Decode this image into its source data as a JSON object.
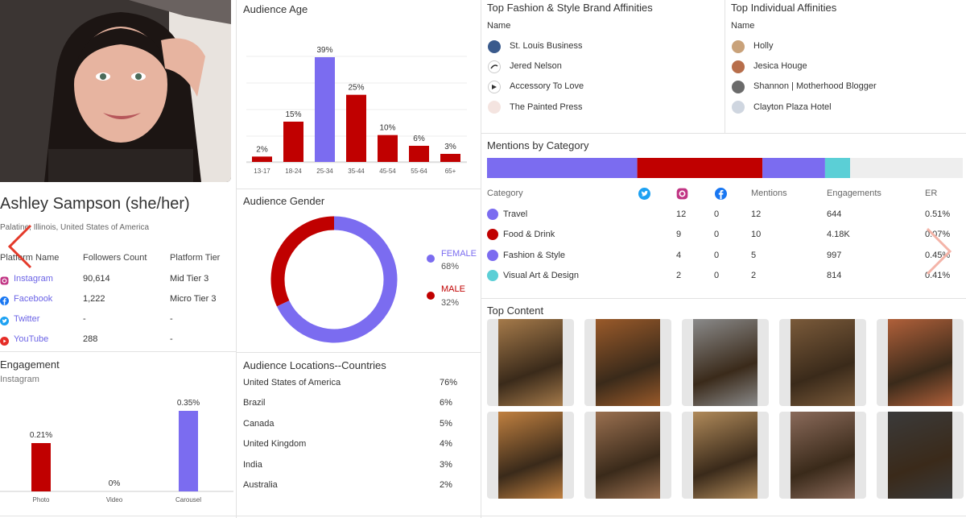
{
  "profile": {
    "name": "Ashley Sampson (she/her)",
    "location": "Palatine, Illinois, United States of America",
    "table_headers": [
      "Platform Name",
      "Followers Count",
      "Platform Tier"
    ],
    "platforms": [
      {
        "name": "Instagram",
        "followers": "90,614",
        "tier": "Mid Tier 3",
        "icon": "instagram-icon",
        "color": "#c13584"
      },
      {
        "name": "Facebook",
        "followers": "1,222",
        "tier": "Micro Tier 3",
        "icon": "facebook-icon",
        "color": "#1877f2"
      },
      {
        "name": "Twitter",
        "followers": "-",
        "tier": "-",
        "icon": "twitter-icon",
        "color": "#1da1f2"
      },
      {
        "name": "YouTube",
        "followers": "288",
        "tier": "-",
        "icon": "youtube-icon",
        "color": "#e52d27"
      }
    ]
  },
  "engagement": {
    "title": "Engagement",
    "subtitle": "Instagram",
    "chart_data": {
      "type": "bar",
      "categories": [
        "Photo",
        "Video",
        "Carousel"
      ],
      "values": [
        0.21,
        0,
        0.35
      ],
      "value_labels": [
        "0.21%",
        "0%",
        "0.35%"
      ],
      "colors": [
        "#c00000",
        "#7b6cf0",
        "#7b6cf0"
      ]
    }
  },
  "audience_age": {
    "title": "Audience Age",
    "chart_data": {
      "type": "bar",
      "categories": [
        "13-17",
        "18-24",
        "25-34",
        "35-44",
        "45-54",
        "55-64",
        "65+"
      ],
      "values": [
        2,
        15,
        39,
        25,
        10,
        6,
        3
      ],
      "value_labels": [
        "2%",
        "15%",
        "39%",
        "25%",
        "10%",
        "6%",
        "3%"
      ],
      "highlight_index": 2,
      "colors": {
        "default": "#c00000",
        "highlight": "#7b6cf0"
      }
    }
  },
  "audience_gender": {
    "title": "Audience Gender",
    "chart_data": {
      "type": "pie",
      "categories": [
        "FEMALE",
        "MALE"
      ],
      "values": [
        68,
        32
      ],
      "value_labels": [
        "68%",
        "32%"
      ],
      "colors": [
        "#7b6cf0",
        "#c00000"
      ]
    }
  },
  "audience_locations": {
    "title": "Audience Locations--Countries",
    "rows": [
      {
        "country": "United States of America",
        "pct": "76%"
      },
      {
        "country": "Brazil",
        "pct": "6%"
      },
      {
        "country": "Canada",
        "pct": "5%"
      },
      {
        "country": "United Kingdom",
        "pct": "4%"
      },
      {
        "country": "India",
        "pct": "3%"
      },
      {
        "country": "Australia",
        "pct": "2%"
      }
    ]
  },
  "brand_affinities": {
    "title": "Top Fashion & Style Brand Affinities",
    "column": "Name",
    "items": [
      {
        "name": "St. Louis Business",
        "color": "#3a5a8c"
      },
      {
        "name": "Jered Nelson",
        "color": "#2a2a2a"
      },
      {
        "name": "Accessory To Love",
        "color": "#555555"
      },
      {
        "name": "The Painted Press",
        "color": "#d9a0a0"
      }
    ]
  },
  "individual_affinities": {
    "title": "Top Individual Affinities",
    "column": "Name",
    "items": [
      {
        "name": "Holly",
        "color": "#c9a27a"
      },
      {
        "name": "Jesica Houge",
        "color": "#b76e4b"
      },
      {
        "name": "Shannon | Motherhood Blogger",
        "color": "#6b6b6b"
      },
      {
        "name": "Clayton Plaza Hotel",
        "color": "#cfd6e0"
      }
    ]
  },
  "mentions": {
    "title": "Mentions by Category",
    "headers": {
      "category": "Category",
      "mentions": "Mentions",
      "engagements": "Engagements",
      "er": "ER"
    },
    "chart_data": {
      "type": "bar",
      "categories": [
        "Travel",
        "Food & Drink",
        "Fashion & Style",
        "Visual Art & Design"
      ],
      "values": [
        12,
        10,
        5,
        2
      ]
    },
    "rows": [
      {
        "category": "Travel",
        "twitter": "12",
        "instagram": "0",
        "facebook": "12",
        "mentions": "644",
        "engagements": "0.51%",
        "er": "",
        "color": "#7b6cf0"
      },
      {
        "category": "Food & Drink",
        "twitter": "9",
        "instagram": "0",
        "facebook": "10",
        "mentions": "4.18K",
        "engagements": "0.07%",
        "er": "",
        "color": "#c00000"
      },
      {
        "category": "Fashion & Style",
        "twitter": "4",
        "instagram": "0",
        "facebook": "5",
        "mentions": "997",
        "engagements": "0.45%",
        "er": "",
        "color": "#7b6cf0"
      },
      {
        "category": "Visual Art & Design",
        "twitter": "2",
        "instagram": "0",
        "facebook": "2",
        "mentions": "814",
        "engagements": "0.41%",
        "er": "",
        "color": "#5bcfd6"
      }
    ]
  },
  "top_content": {
    "title": "Top Content",
    "thumbs": [
      {
        "color": "#a57a4a"
      },
      {
        "color": "#9a5a2a"
      },
      {
        "color": "#8a8a8a"
      },
      {
        "color": "#7a5a3a"
      },
      {
        "color": "#b0603a"
      },
      {
        "color": "#c08040"
      },
      {
        "color": "#9a7050"
      },
      {
        "color": "#b08a5a"
      },
      {
        "color": "#8a6a5a"
      },
      {
        "color": "#3a3a3a"
      }
    ]
  }
}
